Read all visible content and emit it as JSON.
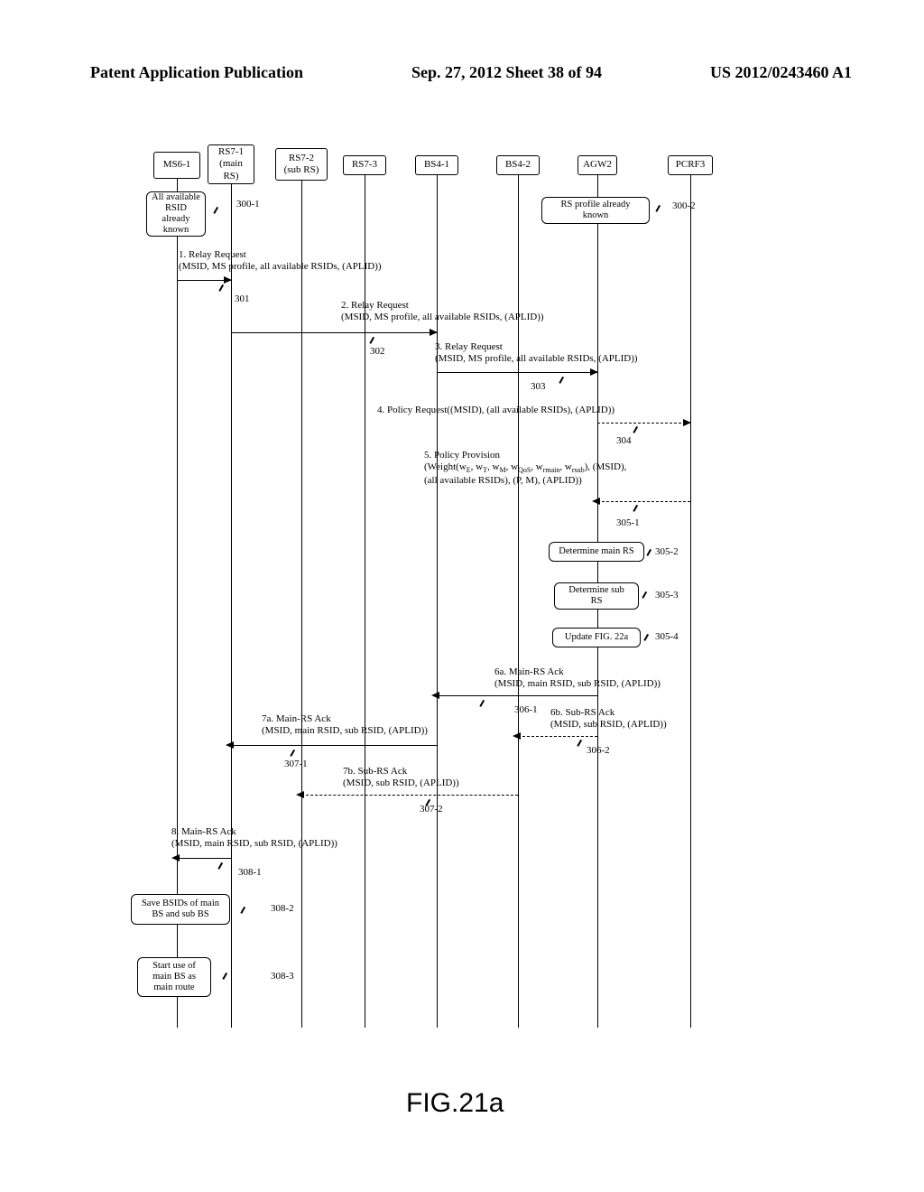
{
  "header": {
    "left": "Patent Application Publication",
    "center": "Sep. 27, 2012  Sheet 38 of 94",
    "right": "US 2012/0243460 A1"
  },
  "lifelines": {
    "ms": "MS6-1",
    "rs71": "RS7-1\n(main\nRS)",
    "rs72": "RS7-2\n(sub RS)",
    "rs73": "RS7-3",
    "bs41": "BS4-1",
    "bs42": "BS4-2",
    "agw": "AGW2",
    "pcrf": "PCRF3"
  },
  "notes": {
    "n300_1": "All available\nRSID\nalready\nknown",
    "n300_2": "RS profile already\nknown",
    "n305_2": "Determine main RS",
    "n305_3": "Determine sub\nRS",
    "n305_4": "Update FIG. 22a",
    "n308_2": "Save BSIDs of main\nBS and sub BS",
    "n308_3": "Start use of\nmain BS as\nmain route"
  },
  "refs": {
    "r300_1": "300-1",
    "r300_2": "300-2",
    "r301": "301",
    "r302": "302",
    "r303": "303",
    "r304": "304",
    "r305_1": "305-1",
    "r305_2": "305-2",
    "r305_3": "305-3",
    "r305_4": "305-4",
    "r306_1": "306-1",
    "r306_2": "306-2",
    "r307_1": "307-1",
    "r307_2": "307-2",
    "r308_1": "308-1",
    "r308_2": "308-2",
    "r308_3": "308-3"
  },
  "msgs": {
    "m1": "1. Relay Request\n(MSID, MS profile, all available RSIDs, (APLID))",
    "m2": "2. Relay Request\n(MSID, MS profile, all available RSIDs, (APLID))",
    "m3": "3. Relay Request\n(MSID, MS profile, all available RSIDs, (APLID))",
    "m4": "4. Policy Request((MSID), (all available RSIDs), (APLID))",
    "m5": "5. Policy Provision\n(Weight(wE, wT, wM, wQoS, wrmain, wrsub), (MSID),\n(all available RSIDs), (P, M), (APLID))",
    "m6a": "6a. Main-RS Ack\n(MSID, main RSID, sub RSID, (APLID))",
    "m6b": "6b. Sub-RS Ack\n(MSID, sub RSID, (APLID))",
    "m7a": "7a. Main-RS Ack\n(MSID, main RSID, sub RSID, (APLID))",
    "m7b": "7b. Sub-RS Ack\n(MSID, sub RSID, (APLID))",
    "m8": "8. Main-RS Ack\n(MSID, main RSID, sub RSID, (APLID))"
  },
  "figure_caption": "FIG.21a"
}
